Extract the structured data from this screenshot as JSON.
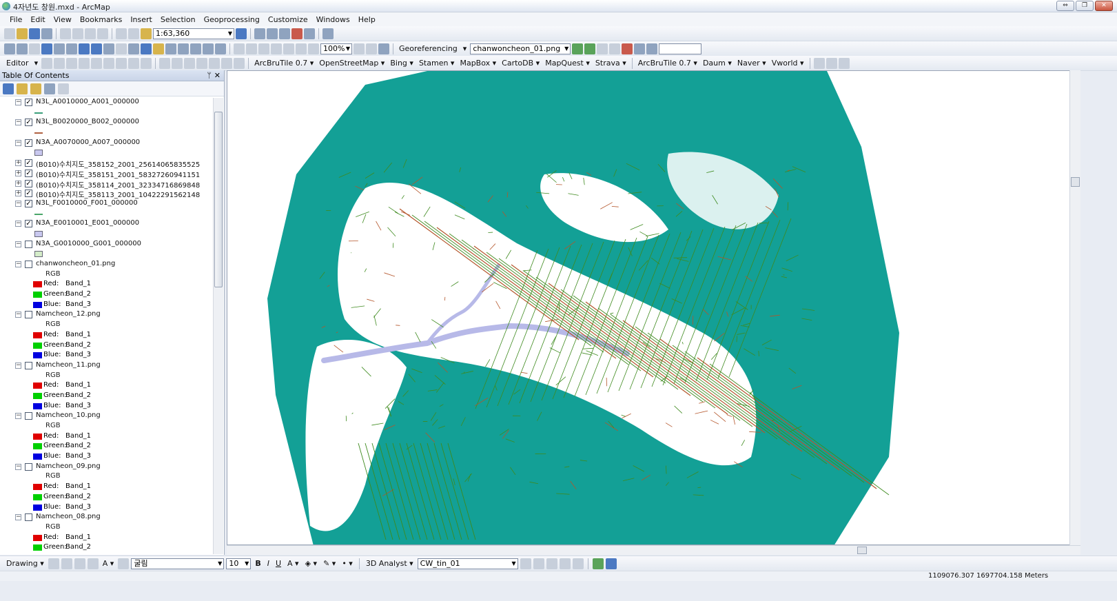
{
  "window": {
    "title": "4자년도 창원.mxd - ArcMap",
    "buttons": [
      "⇔",
      "❐",
      "✕"
    ]
  },
  "menu": [
    "File",
    "Edit",
    "View",
    "Bookmarks",
    "Insert",
    "Selection",
    "Geoprocessing",
    "Customize",
    "Windows",
    "Help"
  ],
  "toolbar": {
    "scale": "1:63,360",
    "zoom_percent": "100%",
    "georeferencing_label": "Georeferencing",
    "georef_layer": "chanwoncheon_01.png",
    "editor_label": "Editor",
    "tile_plugins_1": [
      "ArcBruTile 0.7",
      "OpenStreetMap",
      "Bing",
      "Stamen",
      "MapBox",
      "CartoDB",
      "MapQuest",
      "Strava"
    ],
    "tile_plugins_2": [
      "ArcBruTile 0.7",
      "Daum",
      "Naver",
      "Vworld"
    ]
  },
  "toc": {
    "title": "Table Of Contents",
    "pin": "ᛘ",
    "close": "✕",
    "layers": [
      {
        "name": "N3L_A0010000_A001_000000",
        "checked": true,
        "symbol": "line",
        "color": "#3a9f7a"
      },
      {
        "name": "N3L_B0020000_B002_000000",
        "checked": true,
        "symbol": "line",
        "color": "#b06040"
      },
      {
        "name": "N3A_A0070000_A007_000000",
        "checked": true,
        "symbol": "box",
        "color": "#c9c8ef"
      },
      {
        "name": "(B010)수치지도_358152_2001_25614065835525",
        "checked": true,
        "symbol": "none"
      },
      {
        "name": "(B010)수치지도_358151_2001_58327260941151",
        "checked": true,
        "symbol": "none"
      },
      {
        "name": "(B010)수치지도_358114_2001_32334716869848",
        "checked": true,
        "symbol": "none"
      },
      {
        "name": "(B010)수치지도_358113_2001_10422291562148",
        "checked": true,
        "symbol": "none"
      },
      {
        "name": "N3L_F0010000_F001_000000",
        "checked": true,
        "symbol": "line",
        "color": "#4aa66a"
      },
      {
        "name": "N3A_E0010001_E001_000000",
        "checked": true,
        "symbol": "box",
        "color": "#c9c8ef"
      },
      {
        "name": "N3A_G0010000_G001_000000",
        "checked": false,
        "symbol": "box",
        "color": "#d4ecc8"
      }
    ],
    "rasters": [
      {
        "name": "chanwoncheon_01.png"
      },
      {
        "name": "Namcheon_12.png"
      },
      {
        "name": "Namcheon_11.png"
      },
      {
        "name": "Namcheon_10.png"
      },
      {
        "name": "Namcheon_09.png"
      },
      {
        "name": "Namcheon_08.png"
      }
    ],
    "rgb_label": "RGB",
    "bands": [
      {
        "label": "Red:",
        "value": "Band_1",
        "color": "#e00000"
      },
      {
        "label": "Green:",
        "value": "Band_2",
        "color": "#00d000"
      },
      {
        "label": "Blue:",
        "value": "Band_3",
        "color": "#0000e0"
      }
    ]
  },
  "map": {
    "fill_color": "#13a096",
    "network_color": "#3e8a1e",
    "river_color": "#b7b9e8",
    "road_color": "#b4552a"
  },
  "drawing": {
    "label": "Drawing",
    "font_name": "굴림",
    "font_size": "10",
    "bold": "B",
    "italic": "I",
    "underline": "U",
    "analyst_label": "3D Analyst",
    "tin_layer": "CW_tin_01"
  },
  "status": {
    "coordinates": "1109076.307  1697704.158 Meters"
  }
}
